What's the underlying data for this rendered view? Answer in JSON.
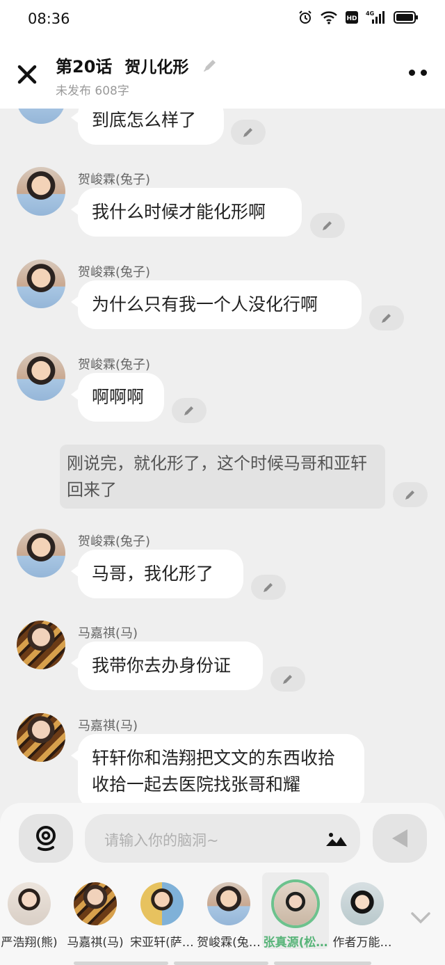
{
  "status": {
    "time": "08:36",
    "network": "4G"
  },
  "header": {
    "chapter": "第20话",
    "title": "贺儿化形",
    "subtitle": "未发布 608字"
  },
  "messages": [
    {
      "type": "char",
      "name": "",
      "avatar": "he",
      "text": "到底怎么样了"
    },
    {
      "type": "char",
      "name": "贺峻霖(兔子)",
      "avatar": "he",
      "text": "我什么时候才能化形啊"
    },
    {
      "type": "char",
      "name": "贺峻霖(兔子)",
      "avatar": "he",
      "text": "为什么只有我一个人没化行啊"
    },
    {
      "type": "char",
      "name": "贺峻霖(兔子)",
      "avatar": "he",
      "text": "啊啊啊"
    },
    {
      "type": "narration",
      "text": "刚说完，就化形了，这个时候马哥和亚轩回来了"
    },
    {
      "type": "char",
      "name": "贺峻霖(兔子)",
      "avatar": "he",
      "text": "马哥，我化形了"
    },
    {
      "type": "char",
      "name": "马嘉祺(马)",
      "avatar": "ma",
      "text": "我带你去办身份证"
    },
    {
      "type": "char",
      "name": "马嘉祺(马)",
      "avatar": "ma",
      "text": "轩轩你和浩翔把文文的东西收拾收拾一起去医院找张哥和耀"
    }
  ],
  "input": {
    "placeholder": "请输入你的脑洞~"
  },
  "characters": [
    {
      "label": "严浩翔(熊)",
      "selected": false
    },
    {
      "label": "马嘉祺(马)",
      "selected": false
    },
    {
      "label": "宋亚轩(萨…",
      "selected": false
    },
    {
      "label": "贺峻霖(兔…",
      "selected": false
    },
    {
      "label": "张真源(松…",
      "selected": true
    },
    {
      "label": "作者万能…",
      "selected": false
    }
  ],
  "colors": {
    "accent": "#58b479",
    "background": "#efefef",
    "bubble": "#ffffff"
  }
}
